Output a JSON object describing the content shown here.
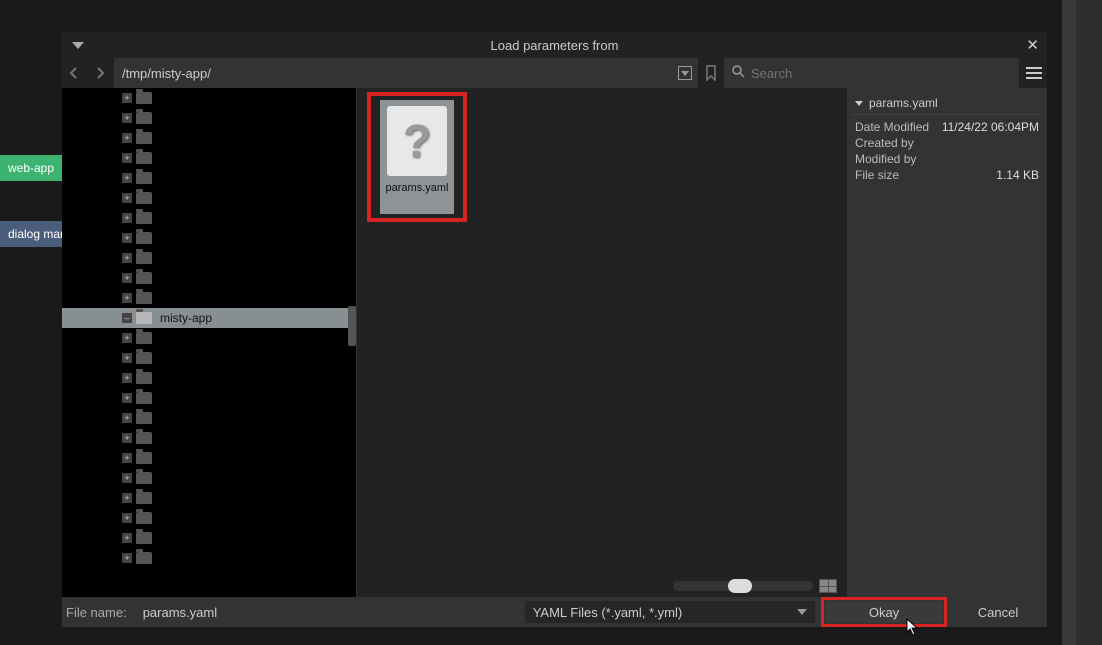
{
  "bg": {
    "tab1": "web-app",
    "tab2": "dialog man"
  },
  "dialog": {
    "title": "Load parameters from",
    "path": "/tmp/misty-app/",
    "search_placeholder": "Search",
    "tree": {
      "selected_label": "misty-app",
      "expand_plus": "+",
      "expand_minus": "–"
    },
    "file": {
      "name": "params.yaml"
    },
    "details": {
      "name": "params.yaml",
      "rows": {
        "date_modified_k": "Date Modified",
        "date_modified_v": "11/24/22 06:04PM",
        "created_k": "Created by",
        "created_v": "",
        "modified_k": "Modified by",
        "modified_v": "",
        "size_k": "File size",
        "size_v": "1.14 KB"
      }
    },
    "bottom": {
      "filename_label": "File name:",
      "filename_value": "params.yaml",
      "filter": "YAML Files (*.yaml, *.yml)",
      "okay": "Okay",
      "cancel": "Cancel"
    }
  }
}
